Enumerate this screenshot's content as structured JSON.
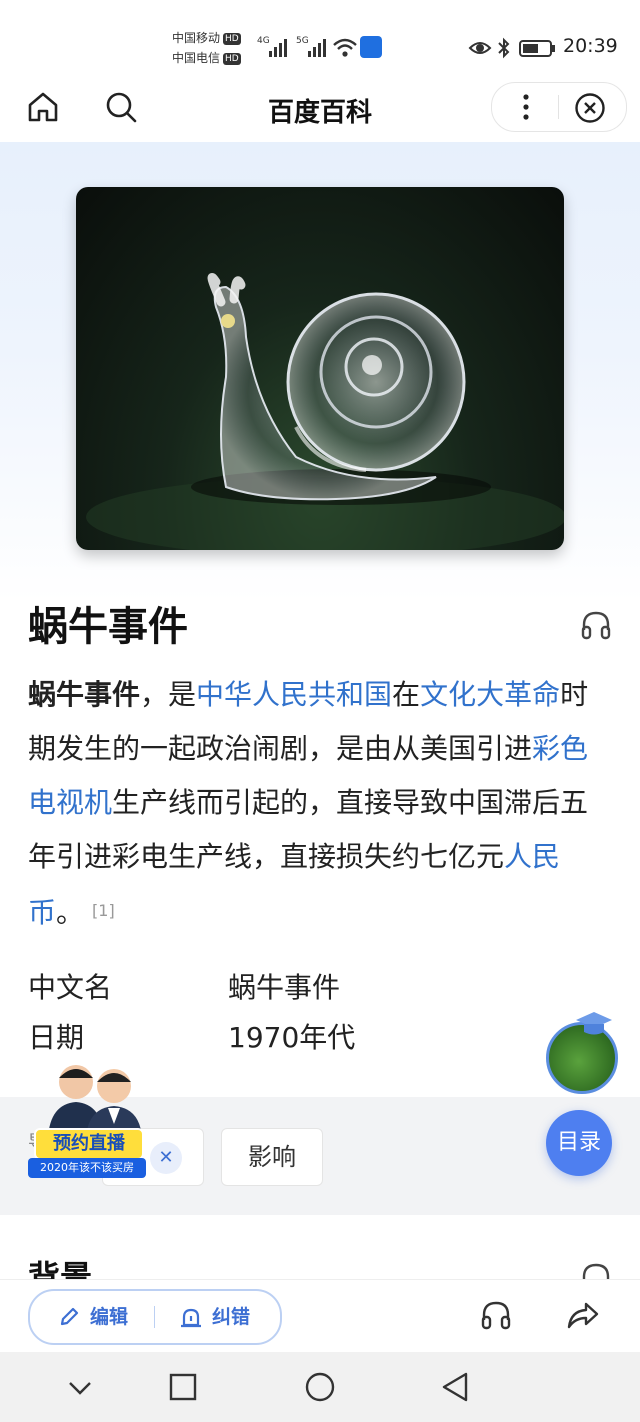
{
  "status_bar": {
    "carrier1": "中国移动",
    "carrier2": "中国电信",
    "hd": "HD",
    "net1": "4G",
    "net2": "5G",
    "time": "20:39"
  },
  "topbar": {
    "title": "百度百科"
  },
  "article": {
    "title": "蜗牛事件",
    "summary": {
      "bold_term": "蜗牛事件",
      "t1": "，是",
      "link_prc": "中华人民共和国",
      "t2": "在",
      "link_cr": "文化大革命",
      "t3": "时期发生的一起政治闹剧，是由从美国引进",
      "link_tv": "彩色电视机",
      "t4": "生产线而引起的，直接导致中国滞后五年引进彩电生产线，直接损失约七亿元",
      "link_rmb": "人民币",
      "t5": "。",
      "ref": "[1]"
    },
    "info": [
      {
        "key": "中文名",
        "value": "蜗牛事件"
      },
      {
        "key": "日期",
        "value": "1970年代"
      }
    ]
  },
  "nav": {
    "label": "导航",
    "chips": [
      "影响"
    ]
  },
  "section": {
    "title": "背景"
  },
  "promo": {
    "title": "预约直播",
    "subtitle": "2020年该不该买房"
  },
  "toc_button": "目录",
  "bottom_toolbar": {
    "edit": "编辑",
    "correct": "纠错"
  },
  "colors": {
    "link": "#3172cc",
    "accent": "#4e7ff0"
  }
}
